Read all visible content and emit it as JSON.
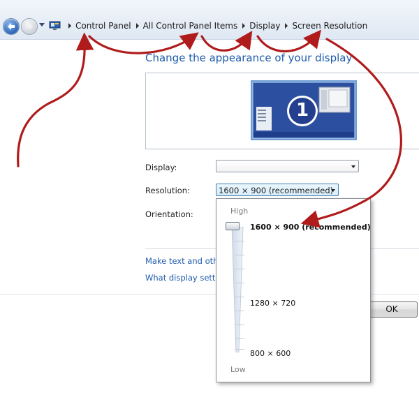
{
  "breadcrumb": {
    "items": [
      "Control Panel",
      "All Control Panel Items",
      "Display",
      "Screen Resolution"
    ]
  },
  "page": {
    "title": "Change the appearance of your display",
    "monitor_number": "1"
  },
  "form": {
    "display_label": "Display:",
    "display_value": "",
    "resolution_label": "Resolution:",
    "resolution_value": "1600 × 900 (recommended)",
    "orientation_label": "Orientation:"
  },
  "links": {
    "make_text": "Make text and other",
    "what_settings": "What display setting"
  },
  "dropdown": {
    "high_label": "High",
    "low_label": "Low",
    "options": [
      "1600 × 900 (recommended)",
      "1280 × 720",
      "800 × 600"
    ],
    "selected_level": 1.0
  },
  "buttons": {
    "ok": "OK"
  },
  "colors": {
    "link": "#1f5cad",
    "title": "#1d5aab",
    "annotation_arrow": "#b01c1c",
    "monitor_fill": "#2d4fa0"
  },
  "icons": [
    "back-arrow-icon",
    "forward-arrow-icon",
    "recent-pages-icon",
    "control-panel-icon",
    "monitor-icon"
  ]
}
